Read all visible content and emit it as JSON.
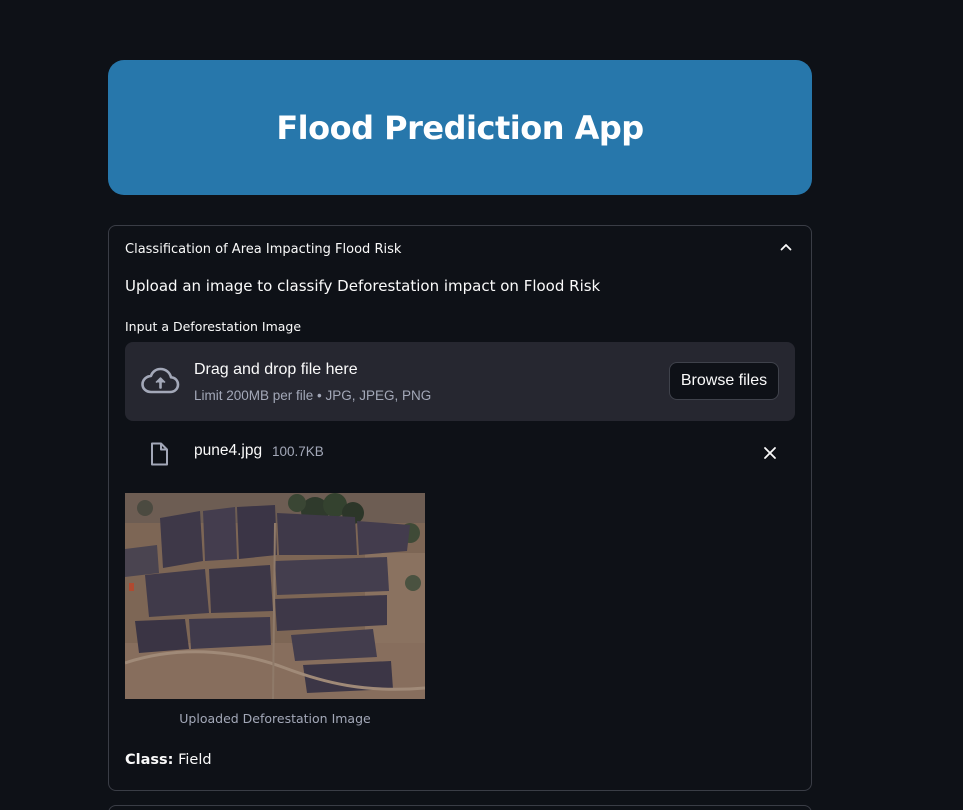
{
  "banner": {
    "title": "Flood Prediction App",
    "color": "#2777ab"
  },
  "expander": {
    "header": "Classification of Area Impacting Flood Risk",
    "toggle_icon": "chevron-up-icon",
    "description": "Upload an image to classify Deforestation impact on Flood Risk"
  },
  "uploader": {
    "label": "Input a Deforestation Image",
    "drop_title": "Drag and drop file here",
    "drop_hint": "Limit 200MB per file • JPG, JPEG, PNG",
    "browse_label": "Browse files",
    "icon": "cloud-upload-icon"
  },
  "file": {
    "name": "pune4.jpg",
    "size": "100.7KB",
    "icon": "file-icon",
    "remove_icon": "close-icon"
  },
  "image": {
    "caption": "Uploaded Deforestation Image"
  },
  "result": {
    "label": "Class:",
    "value": "Field"
  },
  "colors": {
    "background": "#0e1117",
    "dropzone": "#262730",
    "border": "#3a3d46"
  }
}
